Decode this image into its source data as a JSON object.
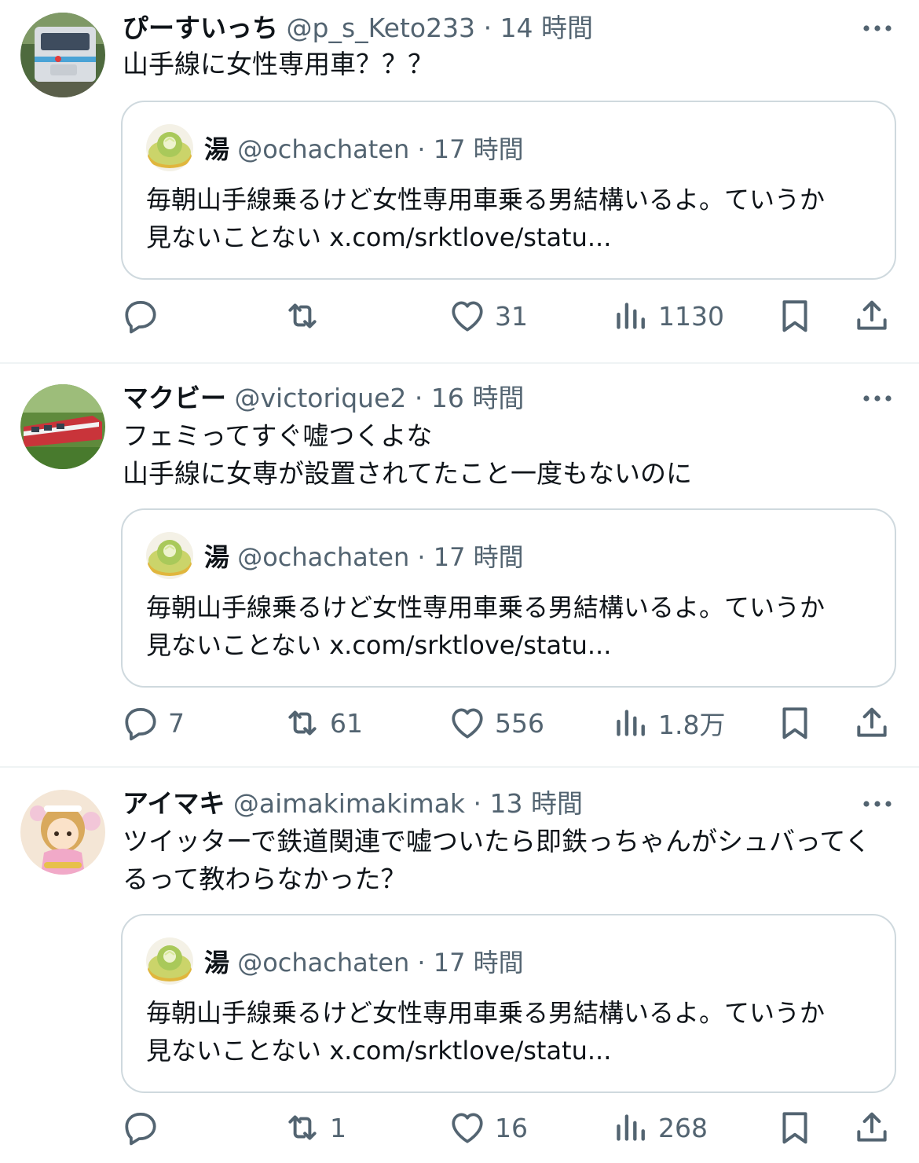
{
  "colors": {
    "text": "#0f1419",
    "secondary": "#536471",
    "border": "#cfd9de",
    "divider": "#eff3f4"
  },
  "quote": {
    "name": "湯",
    "handle": "@ochachaten",
    "time": "17 時間",
    "text": "毎朝山手線乗るけど女性専用車乗る男結構いるよ。ていうか\n見ないことない x.com/srktlove/statu..."
  },
  "tweets": [
    {
      "name": "ぴーすいっち",
      "handle": "@p_s_Keto233",
      "time": "14 時間",
      "text": "山手線に女性専用車？？？",
      "actions": {
        "reply": "",
        "retweet": "",
        "like": "31",
        "views": "1130"
      }
    },
    {
      "name": "マクビー",
      "handle": "@victorique2",
      "time": "16 時間",
      "text": "フェミってすぐ嘘つくよな\n山手線に女専が設置されてたこと一度もないのに",
      "actions": {
        "reply": "7",
        "retweet": "61",
        "like": "556",
        "views": "1.8万"
      }
    },
    {
      "name": "アイマキ",
      "handle": "@aimakimakimak",
      "time": "13 時間",
      "text": "ツイッターで鉄道関連で嘘ついたら即鉄っちゃんがシュバってく\nるって教わらなかった？",
      "actions": {
        "reply": "",
        "retweet": "1",
        "like": "16",
        "views": "268"
      }
    }
  ],
  "icons": [
    "more-icon",
    "reply-icon",
    "retweet-icon",
    "like-icon",
    "views-icon",
    "bookmark-icon",
    "share-icon"
  ]
}
